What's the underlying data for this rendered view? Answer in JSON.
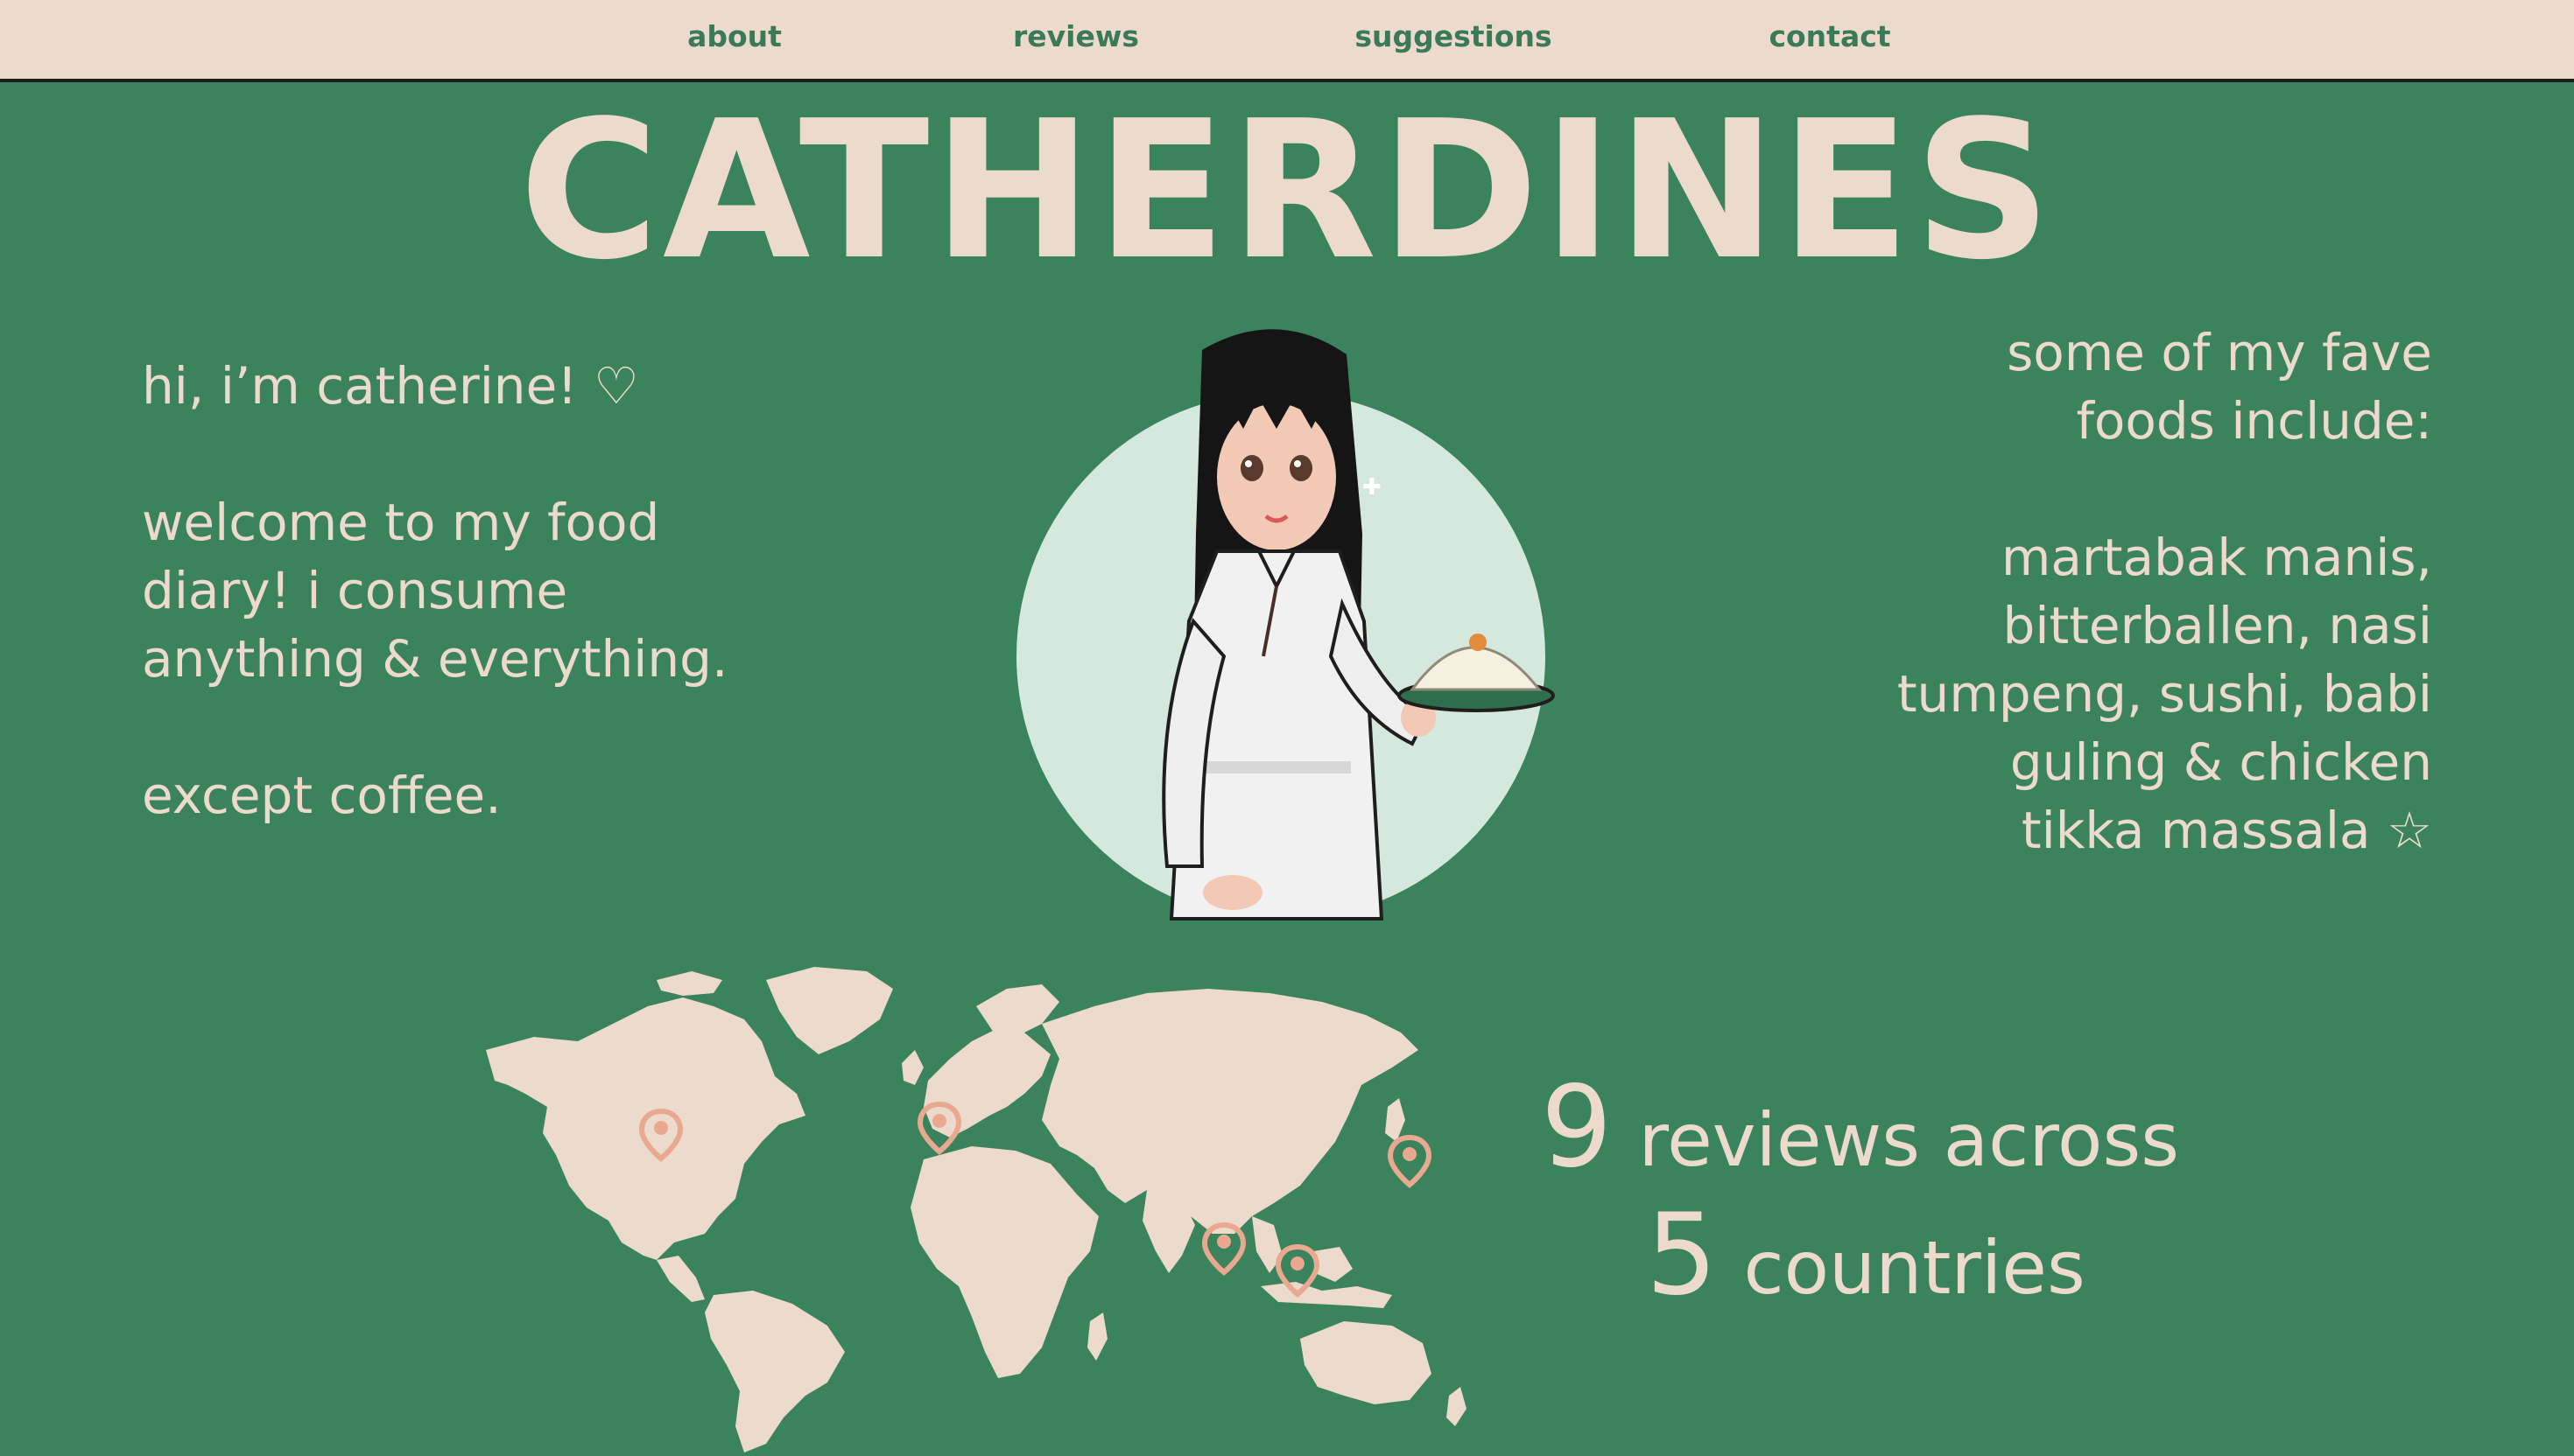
{
  "nav": {
    "items": [
      {
        "label": "about"
      },
      {
        "label": "reviews"
      },
      {
        "label": "suggestions"
      },
      {
        "label": "contact"
      }
    ]
  },
  "site_title": "CATHERDINES",
  "intro": {
    "greeting": "hi, i’m catherine! ♡",
    "welcome": "welcome to my food diary! i consume anything & everything.",
    "exception": "except coffee."
  },
  "faves": {
    "heading": "some of my fave foods include:",
    "list": "martabak manis, bitterballen, nasi tumpeng, sushi, babi guling & chicken tikka massala ☆"
  },
  "stats": {
    "review_count": "9",
    "reviews_text": "reviews across",
    "country_count": "5",
    "countries_text": "countries"
  },
  "icons": {
    "map_pin": "map-pin-icon",
    "heart": "heart-icon",
    "star": "star-icon"
  },
  "colors": {
    "background": "#3b835c",
    "cream": "#ecdacc",
    "nav_text": "#3b7a57",
    "avatar_circle": "#d5e8dd",
    "pin": "#e8a990"
  }
}
